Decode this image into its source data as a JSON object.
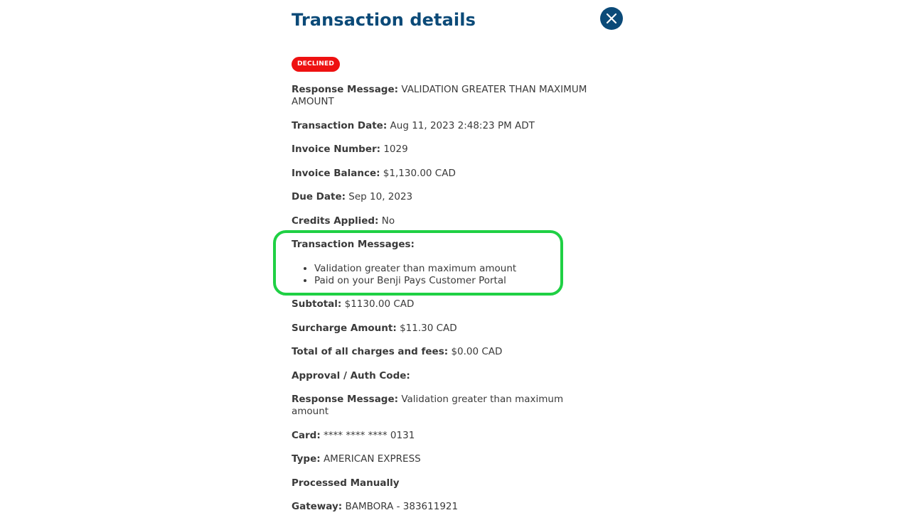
{
  "modal": {
    "title": "Transaction details",
    "close_icon": "close-x-icon",
    "status_badge": "DECLINED",
    "colors": {
      "title": "#0b4a78",
      "close_button": "#0b4a78",
      "badge_bg": "#ee1111",
      "highlight_border": "#1fd044"
    }
  },
  "fields": {
    "response_message_top": {
      "label": "Response Message:",
      "value": "VALIDATION GREATER THAN MAXIMUM AMOUNT"
    },
    "transaction_date": {
      "label": "Transaction Date:",
      "value": "Aug 11, 2023 2:48:23 PM ADT"
    },
    "invoice_number": {
      "label": "Invoice Number:",
      "value": "1029"
    },
    "invoice_balance": {
      "label": "Invoice Balance:",
      "value": "$1,130.00 CAD"
    },
    "due_date": {
      "label": "Due Date:",
      "value": "Sep 10, 2023"
    },
    "credits_applied": {
      "label": "Credits Applied:",
      "value": "No"
    },
    "transaction_messages": {
      "label": "Transaction Messages:",
      "items": [
        "Validation greater than maximum amount",
        "Paid on your Benji Pays Customer Portal"
      ]
    },
    "subtotal": {
      "label": "Subtotal:",
      "value": "$1130.00 CAD"
    },
    "surcharge_amount": {
      "label": "Surcharge Amount:",
      "value": "$11.30 CAD"
    },
    "total_charges_fees": {
      "label": "Total of all charges and fees:",
      "value": "$0.00 CAD"
    },
    "approval_auth_code": {
      "label": "Approval / Auth Code:",
      "value": ""
    },
    "response_message_bottom": {
      "label": "Response Message:",
      "value": "Validation greater than maximum amount"
    },
    "card": {
      "label": "Card:",
      "value": "**** **** **** 0131"
    },
    "type": {
      "label": "Type:",
      "value": "AMERICAN EXPRESS"
    },
    "processed_manually": {
      "label": "Processed Manually"
    },
    "gateway": {
      "label": "Gateway:",
      "value": "BAMBORA - 383611921"
    }
  }
}
